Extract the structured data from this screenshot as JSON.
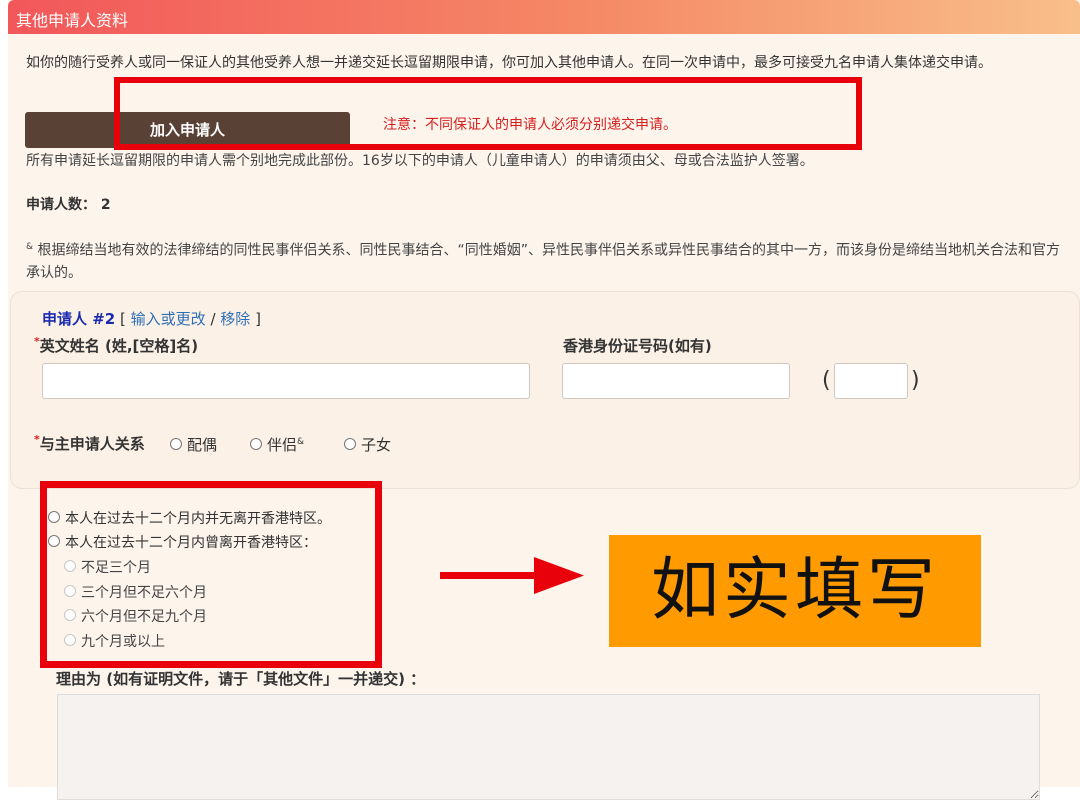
{
  "header": {
    "title": "其他申请人资料"
  },
  "intro_text": "如你的随行受养人或同一保证人的其他受养人想一并递交延长逗留期限申请，你可加入其他申请人。在同一次申请中，最多可接受九名申请人集体递交申请。",
  "add_button_label": "加入申请人",
  "note_text": "注意：不同保证人的申请人必须分别递交申请。",
  "partially_hidden_text": "所有申请延长逗留期限的申请人需个别地完成此部份。16岁以下的申请人（儿童申请人）的申请须由父、母或合法监护人签署。",
  "applicant_count": {
    "label": "申请人数：",
    "value": "2"
  },
  "footnote": {
    "marker": "&",
    "text": " 根据缔结当地有效的法律缔结的同性民事伴侣关系、同性民事结合、“同性婚姻”、异性民事伴侣关系或异性民事结合的其中一方，而该身份是缔结当地机关合法和官方承认的。"
  },
  "applicant": {
    "title": "申请人 #2",
    "bracket_open": "[",
    "edit_link": "输入或更改",
    "separator": "/",
    "remove_link": "移除",
    "bracket_close": "]",
    "required_mark": "*",
    "name_label": "英文姓名 (姓,[空格]名)",
    "name_value": "",
    "hkid_label": "香港身份证号码(如有)",
    "hkid_value": "",
    "paren_open": "(",
    "paren_close": ")",
    "check_digit_value": "",
    "relation_label": "与主申请人关系",
    "relation_options": [
      "配偶",
      "伴侣",
      "子女"
    ],
    "partner_marker": "&"
  },
  "stay": {
    "option_no_leave": "本人在过去十二个月内并无离开香港特区。",
    "option_left": "本人在过去十二个月内曾离开香港特区：",
    "durations": [
      "不足三个月",
      "三个月但不足六个月",
      "六个月但不足九个月",
      "九个月或以上"
    ]
  },
  "callout_text": "如实填写",
  "reason_label": "理由为 (如有证明文件，请于「其他文件」一并递交) ：",
  "reason_value": "",
  "annotation_colors": {
    "red": "#e8000a",
    "callout_bg": "#ff9a00",
    "header_start": "#f2575a",
    "button_bg": "#5a4136"
  }
}
